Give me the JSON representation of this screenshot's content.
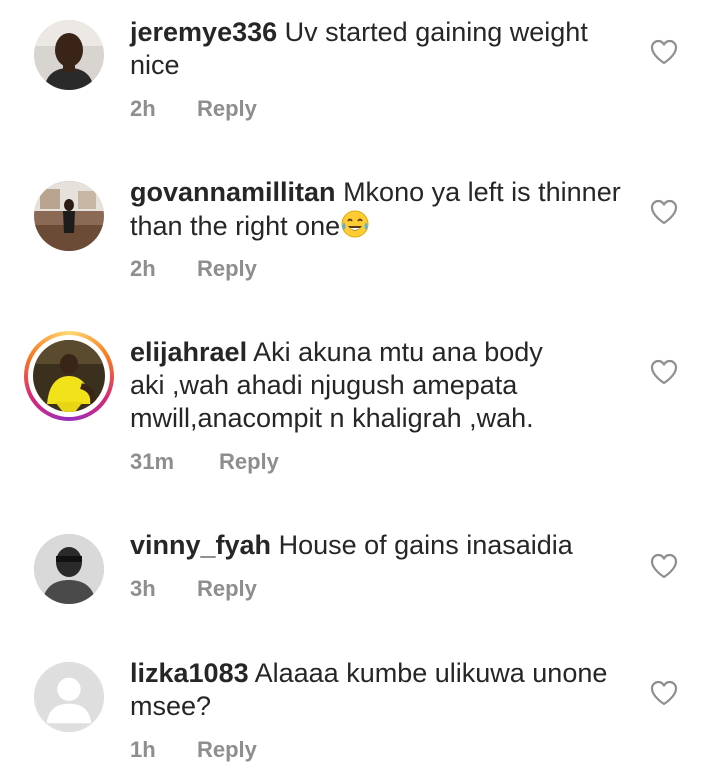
{
  "comments": [
    {
      "username": "jeremye336",
      "text": "Uv started gaining weight nice",
      "time": "2h",
      "reply_label": "Reply",
      "avatar": "photo-avatar",
      "has_story_ring": false
    },
    {
      "username": "govannamillitan",
      "text": "Mkono ya left is thinner than the right one",
      "emoji": "😂",
      "time": "2h",
      "reply_label": "Reply",
      "avatar": "photo-avatar",
      "has_story_ring": false
    },
    {
      "username": "elijahrael",
      "text": "Aki akuna mtu ana body aki ,wah ahadi njugush amepata mwill,anacompit n khaligrah ,wah.",
      "time": "31m",
      "reply_label": "Reply",
      "avatar": "photo-avatar",
      "has_story_ring": true
    },
    {
      "username": "vinny_fyah",
      "text": "House of gains inasaidia",
      "time": "3h",
      "reply_label": "Reply",
      "avatar": "photo-avatar",
      "has_story_ring": false
    },
    {
      "username": "lizka1083",
      "text": "Alaaaa kumbe ulikuwa unone msee?",
      "time": "1h",
      "reply_label": "Reply",
      "avatar": "default-avatar",
      "has_story_ring": false
    }
  ],
  "icons": {
    "like": "heart-outline-icon"
  },
  "colors": {
    "text": "#262626",
    "meta": "#8e8e8e",
    "heart": "#8e8e8e"
  }
}
